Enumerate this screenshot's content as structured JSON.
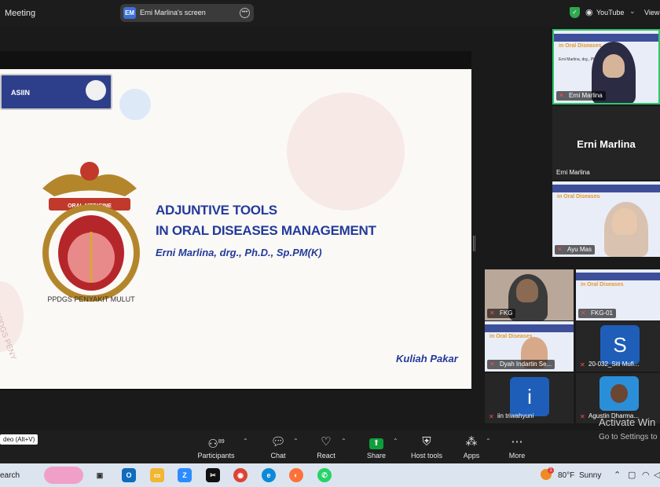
{
  "topbar": {
    "meeting": "Meeting",
    "share_initials": "EM",
    "share_label": "Erni Marlina's screen",
    "stream_label": "YouTube",
    "view_label": "View"
  },
  "slide": {
    "logo_text": "ASIIN",
    "title_line1": "ADJUNTIVE TOOLS",
    "title_line2": "IN ORAL DISEASES MANAGEMENT",
    "author": "Erni Marlina, drg., Ph.D., Sp.PM(K)",
    "footer": "Kuliah Pakar",
    "crest_banner": "ORAL MEDICINE",
    "crest_ring": "PPDGS PENYAKIT MULUT",
    "watermark_vertical": "PPDGS PENY"
  },
  "mini_slide": {
    "title": "in Oral Diseases",
    "subtitle": "Erni Marlina, drg., Ph.D."
  },
  "participants_gallery": [
    {
      "name": "Erni Marlina",
      "type": "video-slide"
    },
    {
      "name": "Erni Marlina",
      "type": "name-only"
    },
    {
      "name": "Ayu Mas",
      "type": "video-slide"
    },
    {
      "name": "FKG",
      "type": "video"
    },
    {
      "name": "FKG-01",
      "type": "video-slide"
    },
    {
      "name": "Dyah Indartin Se...",
      "type": "video-slide"
    },
    {
      "name": "20-032_Siti Mufl...",
      "type": "avatar",
      "initial": "S"
    },
    {
      "name": "iin triwahyuni",
      "type": "avatar",
      "initial": "i"
    },
    {
      "name": "Agustin Dharma...",
      "type": "photo"
    }
  ],
  "toolbar": {
    "video_hint": "deo (Alt+V)",
    "participants_label": "Participants",
    "participants_count": "89",
    "chat_label": "Chat",
    "react_label": "React",
    "share_label": "Share",
    "host_tools_label": "Host tools",
    "apps_label": "Apps",
    "more_label": "More"
  },
  "watermark": {
    "line1": "Activate Win",
    "line2": "Go to Settings to"
  },
  "taskbar": {
    "search_label": "earch",
    "weather_badge": "1",
    "weather_temp": "80°F",
    "weather_cond": "Sunny",
    "apps": [
      "task-view",
      "outlook",
      "file-explorer",
      "zoom",
      "capcut",
      "chrome",
      "edge",
      "firefox",
      "whatsapp"
    ]
  },
  "colors": {
    "accent_blue": "#233a9b",
    "zoom_green": "#0e9f3c",
    "brand_blue": "#1e5eb8"
  }
}
